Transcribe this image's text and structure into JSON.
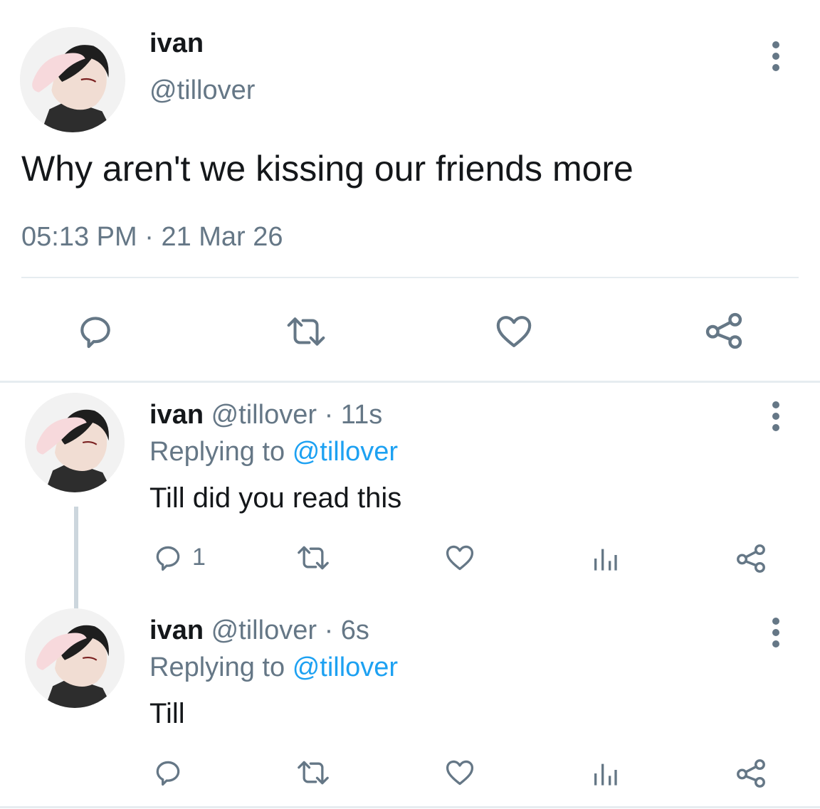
{
  "main_tweet": {
    "display_name": "ivan",
    "handle": "@tillover",
    "text": "Why aren't we kissing our friends more",
    "time": "05:13 PM",
    "separator": "·",
    "date": "21 Mar 26"
  },
  "replies": [
    {
      "display_name": "ivan",
      "handle": "@tillover",
      "separator": "·",
      "age": "11s",
      "replying_prefix": "Replying to",
      "replying_handle": "@tillover",
      "text": "Till did you read this",
      "reply_count": "1"
    },
    {
      "display_name": "ivan",
      "handle": "@tillover",
      "separator": "·",
      "age": "6s",
      "replying_prefix": "Replying to",
      "replying_handle": "@tillover",
      "text": "Till",
      "reply_count": ""
    }
  ],
  "icons": {
    "reply": "reply-icon",
    "retweet": "retweet-icon",
    "like": "heart-icon",
    "analytics": "analytics-icon",
    "share": "share-icon",
    "more": "more-vertical-icon"
  },
  "colors": {
    "text": "#14171a",
    "muted": "#657786",
    "link": "#1da1f2",
    "divider": "#e6ecf0"
  }
}
